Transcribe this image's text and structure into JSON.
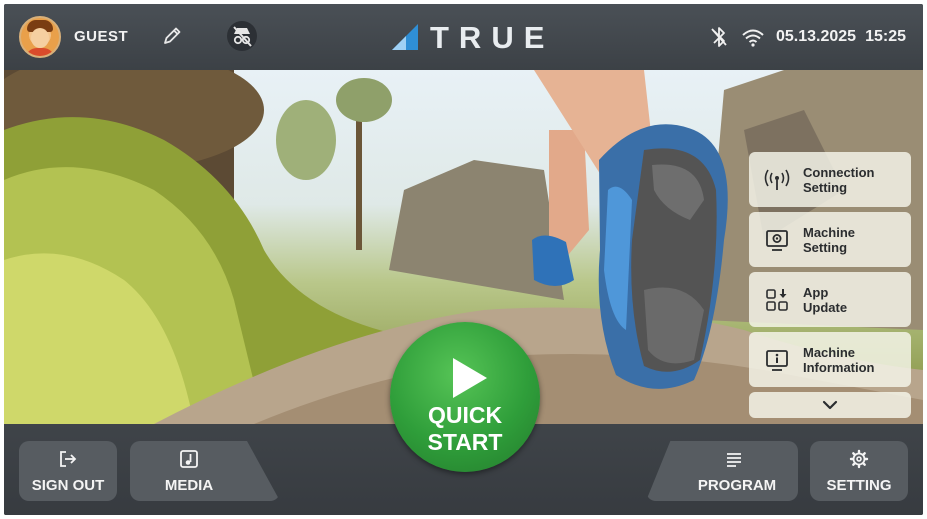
{
  "header": {
    "user_name": "GUEST",
    "logo_text": "TRUE",
    "date": "05.13.2025",
    "time": "15:25"
  },
  "side_menu": {
    "items": [
      {
        "label": "Connection\nSetting",
        "icon": "antenna-icon"
      },
      {
        "label": "Machine\nSetting",
        "icon": "monitor-gear-icon"
      },
      {
        "label": "App\nUpdate",
        "icon": "app-grid-download-icon"
      },
      {
        "label": "Machine\nInformation",
        "icon": "monitor-info-icon"
      }
    ],
    "more_icon": "chevron-down-icon"
  },
  "quick_start": {
    "line1": "QUICK",
    "line2": "START"
  },
  "footer": {
    "sign_out_label": "SIGN OUT",
    "media_label": "MEDIA",
    "program_label": "PROGRAM",
    "setting_label": "SETTING"
  },
  "colors": {
    "bar_background": "#3d4247",
    "button_background": "#575c61",
    "quick_start_green": "#2f9e3a",
    "logo_accent": "#2f8fd6"
  }
}
